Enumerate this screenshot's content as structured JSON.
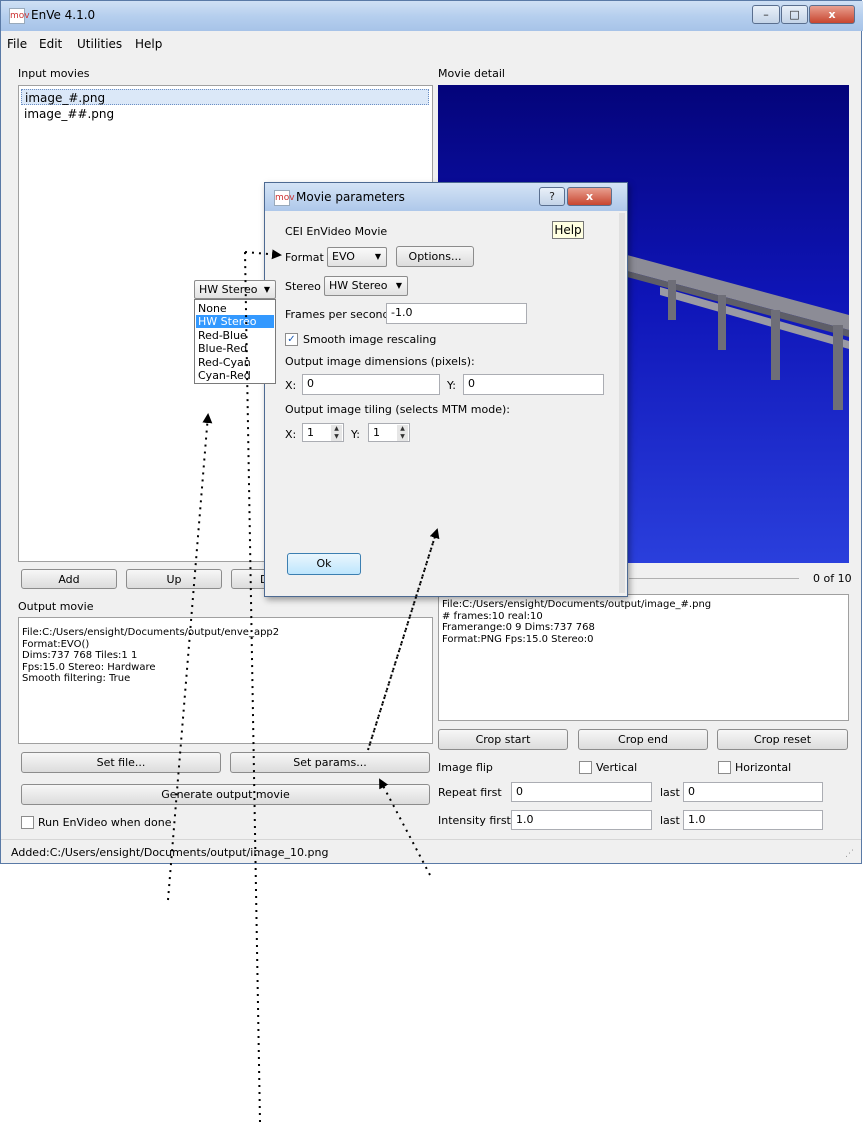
{
  "window": {
    "title": "EnVe 4.1.0",
    "icon_label": "mov",
    "minimize_label": "–",
    "maximize_label": "□",
    "close_label": "x"
  },
  "menu": [
    "File",
    "Edit",
    "Utilities",
    "Help"
  ],
  "input_movies": {
    "label": "Input movies",
    "items": [
      "image_#.png",
      "image_##.png"
    ]
  },
  "movie_detail": {
    "label": "Movie detail",
    "frame_counter": "0 of 10",
    "info": "File:C:/Users/ensight/Documents/output/image_#.png\n# frames:10 real:10\nFramerange:0 9 Dims:737 768\nFormat:PNG Fps:15.0 Stereo:0"
  },
  "list_buttons": {
    "add": "Add",
    "up": "Up",
    "down_partial": "D"
  },
  "output_movie": {
    "label": "Output movie",
    "info": "File:C:/Users/ensight/Documents/output/enve_app2\nFormat:EVO()\nDims:737 768 Tiles:1 1\nFps:15.0 Stereo: Hardware\nSmooth filtering: True",
    "set_file": "Set file...",
    "set_params": "Set params...",
    "generate": "Generate output movie",
    "run_envideo": "Run EnVideo when done",
    "run_envideo_checked": false
  },
  "crop": {
    "start": "Crop start",
    "end": "Crop end",
    "reset": "Crop reset"
  },
  "image_flip": {
    "label": "Image flip",
    "vertical": "Vertical",
    "horizontal": "Horizontal"
  },
  "repeat": {
    "first_label": "Repeat first",
    "first_value": "0",
    "last_label": "last",
    "last_value": "0"
  },
  "intensity": {
    "first_label": "Intensity first",
    "first_value": "1.0",
    "last_label": "last",
    "last_value": "1.0"
  },
  "status_bar": "Added:C:/Users/ensight/Documents/output/image_10.png",
  "dialog": {
    "title": "Movie parameters",
    "help_glyph": "?",
    "close_glyph": "x",
    "subtitle": "CEI EnVideo Movie",
    "help_button": "Help",
    "format_label": "Format",
    "format_value": "EVO",
    "options_button": "Options...",
    "stereo_label": "Stereo",
    "stereo_value": "HW Stereo",
    "fps_label": "Frames per second",
    "fps_value": "-1.0",
    "smooth_label": "Smooth image rescaling",
    "smooth_checked": true,
    "dims_label": "Output image dimensions (pixels):",
    "dim_x_label": "X:",
    "dim_x_value": "0",
    "dim_y_label": "Y:",
    "dim_y_value": "0",
    "tiling_label": "Output image tiling (selects MTM mode):",
    "tile_x_label": "X:",
    "tile_x_value": "1",
    "tile_y_label": "Y:",
    "tile_y_value": "1",
    "ok_button": "Ok"
  },
  "stereo_popup": {
    "current": "HW Stereo",
    "options": [
      "None",
      "HW Stereo",
      "Red-Blue",
      "Blue-Red",
      "Red-Cyan",
      "Cyan-Red"
    ],
    "selected_index": 1
  },
  "colors": {
    "preview_top": "#04047a",
    "preview_bottom": "#2a3fdc",
    "selection": "#3399ff",
    "help_badge": "#ffffe1"
  }
}
